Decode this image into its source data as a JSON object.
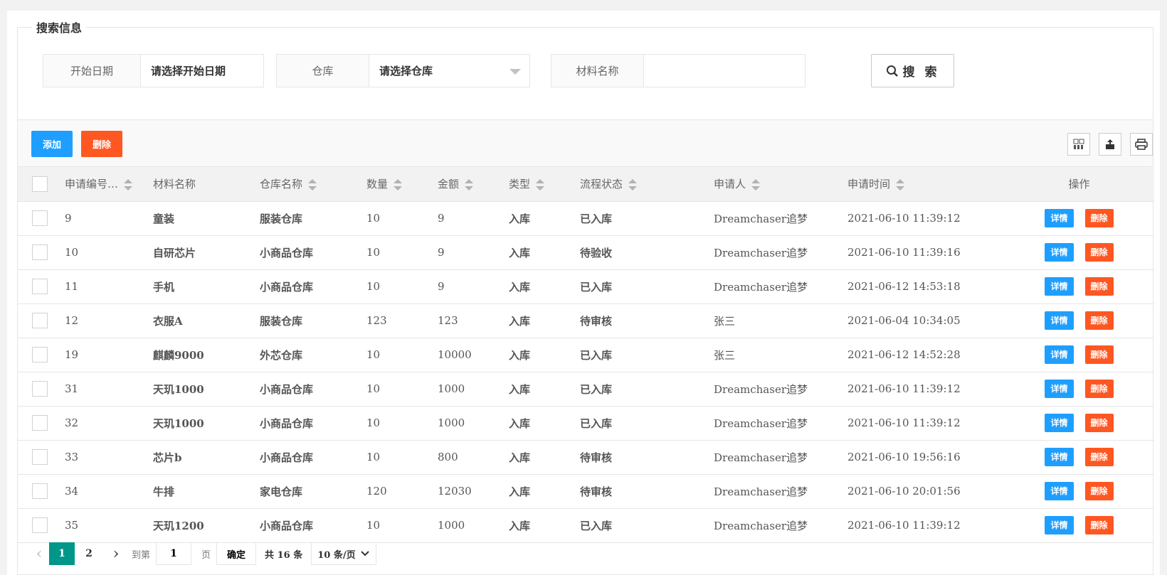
{
  "search": {
    "legend": "搜索信息",
    "start_date": {
      "label": "开始日期",
      "placeholder": "请选择开始日期"
    },
    "warehouse": {
      "label": "仓库",
      "placeholder": "请选择仓库"
    },
    "material": {
      "label": "材料名称",
      "value": ""
    },
    "button": "搜 索"
  },
  "toolbar": {
    "add": "添加",
    "delete": "删除"
  },
  "table": {
    "columns": [
      "申请编号…",
      "材料名称",
      "仓库名称",
      "数量",
      "金额",
      "类型",
      "流程状态",
      "申请人",
      "申请时间",
      "操作"
    ],
    "rows": [
      {
        "id": "9",
        "material": "童装",
        "warehouse": "服装仓库",
        "qty": "10",
        "amount": "9",
        "type": "入库",
        "status": "已入库",
        "applicant": "Dreamchaser追梦",
        "time": "2021-06-10 11:39:12"
      },
      {
        "id": "10",
        "material": "自研芯片",
        "warehouse": "小商品仓库",
        "qty": "10",
        "amount": "9",
        "type": "入库",
        "status": "待验收",
        "applicant": "Dreamchaser追梦",
        "time": "2021-06-10 11:39:16"
      },
      {
        "id": "11",
        "material": "手机",
        "warehouse": "小商品仓库",
        "qty": "10",
        "amount": "9",
        "type": "入库",
        "status": "已入库",
        "applicant": "Dreamchaser追梦",
        "time": "2021-06-12 14:53:18"
      },
      {
        "id": "12",
        "material": "衣服A",
        "warehouse": "服装仓库",
        "qty": "123",
        "amount": "123",
        "type": "入库",
        "status": "待审核",
        "applicant": "张三",
        "time": "2021-06-04 10:34:05"
      },
      {
        "id": "19",
        "material": "麒麟9000",
        "warehouse": "外芯仓库",
        "qty": "10",
        "amount": "10000",
        "type": "入库",
        "status": "已入库",
        "applicant": "张三",
        "time": "2021-06-12 14:52:28"
      },
      {
        "id": "31",
        "material": "天玑1000",
        "warehouse": "小商品仓库",
        "qty": "10",
        "amount": "1000",
        "type": "入库",
        "status": "已入库",
        "applicant": "Dreamchaser追梦",
        "time": "2021-06-10 11:39:12"
      },
      {
        "id": "32",
        "material": "天玑1000",
        "warehouse": "小商品仓库",
        "qty": "10",
        "amount": "1000",
        "type": "入库",
        "status": "已入库",
        "applicant": "Dreamchaser追梦",
        "time": "2021-06-10 11:39:12"
      },
      {
        "id": "33",
        "material": "芯片b",
        "warehouse": "小商品仓库",
        "qty": "10",
        "amount": "800",
        "type": "入库",
        "status": "待审核",
        "applicant": "Dreamchaser追梦",
        "time": "2021-06-10 19:56:16"
      },
      {
        "id": "34",
        "material": "牛排",
        "warehouse": "家电仓库",
        "qty": "120",
        "amount": "12030",
        "type": "入库",
        "status": "待审核",
        "applicant": "Dreamchaser追梦",
        "time": "2021-06-10 20:01:56"
      },
      {
        "id": "35",
        "material": "天玑1200",
        "warehouse": "小商品仓库",
        "qty": "10",
        "amount": "1000",
        "type": "入库",
        "status": "已入库",
        "applicant": "Dreamchaser追梦",
        "time": "2021-06-10 11:39:12"
      }
    ],
    "row_actions": {
      "detail": "详情",
      "delete": "删除"
    }
  },
  "pager": {
    "pages": [
      "1",
      "2"
    ],
    "current": "1",
    "goto_prefix": "到第",
    "goto_value": "1",
    "goto_suffix": "页",
    "confirm": "确定",
    "total": "共 16 条",
    "page_size": "10 条/页"
  },
  "colors": {
    "primary": "#1e9fff",
    "danger": "#ff5722",
    "active_page": "#009688"
  }
}
